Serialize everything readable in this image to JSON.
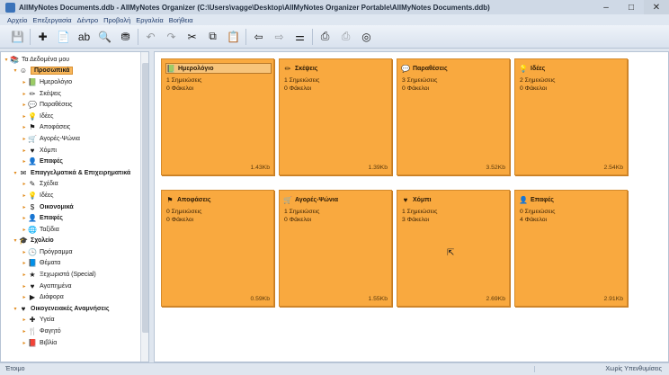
{
  "window": {
    "title": "AllMyNotes Documents.ddb - AllMyNotes Organizer (C:\\Users\\vagge\\Desktop\\AllMyNotes Organizer Portable\\AllMyNotes Documents.ddb)",
    "minimize": "–",
    "maximize": "□",
    "close": "✕"
  },
  "menu": [
    "Αρχείο",
    "Επεξεργασία",
    "Δέντρο",
    "Προβολή",
    "Εργαλεία",
    "Βοήθεια"
  ],
  "toolbar": [
    {
      "name": "save-icon",
      "glyph": "💾",
      "enabled": false
    },
    {
      "sep": true
    },
    {
      "name": "new-note-icon",
      "glyph": "✚",
      "enabled": true
    },
    {
      "name": "new-child-note-icon",
      "glyph": "📄",
      "enabled": true
    },
    {
      "name": "rename-icon",
      "glyph": "ab",
      "enabled": true
    },
    {
      "name": "find-icon",
      "glyph": "🔍",
      "enabled": true
    },
    {
      "name": "filter-icon",
      "glyph": "⛃",
      "enabled": true
    },
    {
      "sep": true
    },
    {
      "name": "undo-icon",
      "glyph": "↶",
      "enabled": false
    },
    {
      "name": "redo-icon",
      "glyph": "↷",
      "enabled": false
    },
    {
      "name": "cut-icon",
      "glyph": "✂",
      "enabled": true
    },
    {
      "name": "copy-icon",
      "glyph": "⧉",
      "enabled": true
    },
    {
      "name": "paste-icon",
      "glyph": "📋",
      "enabled": true
    },
    {
      "sep": true
    },
    {
      "name": "back-icon",
      "glyph": "⇦",
      "enabled": true
    },
    {
      "name": "forward-icon",
      "glyph": "⇨",
      "enabled": false
    },
    {
      "name": "equalizer-icon",
      "glyph": "⚌",
      "enabled": true
    },
    {
      "sep": true
    },
    {
      "name": "print-icon",
      "glyph": "⎙",
      "enabled": true
    },
    {
      "name": "print-preview-icon",
      "glyph": "⎙",
      "enabled": false
    },
    {
      "name": "help-lifebuoy-icon",
      "glyph": "◎",
      "enabled": true
    }
  ],
  "tree": [
    {
      "label": "Τα Δεδομένα μου",
      "level": 0,
      "icon": "📚",
      "bold": false,
      "sel": false,
      "arrow": "▾"
    },
    {
      "label": "Προσωπικά",
      "level": 1,
      "icon": "☺",
      "bold": true,
      "sel": true,
      "arrow": "▾"
    },
    {
      "label": "Ημερολόγιο",
      "level": 2,
      "icon": "📗",
      "bold": false,
      "sel": false,
      "arrow": "▸"
    },
    {
      "label": "Σκέψεις",
      "level": 2,
      "icon": "✏",
      "bold": false,
      "sel": false,
      "arrow": "▸"
    },
    {
      "label": "Παραθέσεις",
      "level": 2,
      "icon": "💬",
      "bold": false,
      "sel": false,
      "arrow": "▸"
    },
    {
      "label": "Ιδέες",
      "level": 2,
      "icon": "💡",
      "bold": false,
      "sel": false,
      "arrow": "▸"
    },
    {
      "label": "Αποφάσεις",
      "level": 2,
      "icon": "⚑",
      "bold": false,
      "sel": false,
      "arrow": "▸"
    },
    {
      "label": "Αγορές-Ψώνια",
      "level": 2,
      "icon": "🛒",
      "bold": false,
      "sel": false,
      "arrow": "▸"
    },
    {
      "label": "Χόμπι",
      "level": 2,
      "icon": "♥",
      "bold": false,
      "sel": false,
      "arrow": "▸"
    },
    {
      "label": "Επαφές",
      "level": 2,
      "icon": "👤",
      "bold": true,
      "sel": false,
      "arrow": "▸"
    },
    {
      "label": "Επαγγελματικά & Επιχειρηματικά",
      "level": 1,
      "icon": "✉",
      "bold": true,
      "sel": false,
      "arrow": "▾"
    },
    {
      "label": "Σχέδια",
      "level": 2,
      "icon": "✎",
      "bold": false,
      "sel": false,
      "arrow": "▸"
    },
    {
      "label": "Ιδέες",
      "level": 2,
      "icon": "💡",
      "bold": false,
      "sel": false,
      "arrow": "▸"
    },
    {
      "label": "Οικονομικά",
      "level": 2,
      "icon": "$",
      "bold": true,
      "sel": false,
      "arrow": "▸"
    },
    {
      "label": "Επαφές",
      "level": 2,
      "icon": "👤",
      "bold": true,
      "sel": false,
      "arrow": "▸"
    },
    {
      "label": "Ταξίδια",
      "level": 2,
      "icon": "🌐",
      "bold": false,
      "sel": false,
      "arrow": "▸"
    },
    {
      "label": "Σχολείο",
      "level": 1,
      "icon": "🎓",
      "bold": true,
      "sel": false,
      "arrow": "▾"
    },
    {
      "label": "Πρόγραμμα",
      "level": 2,
      "icon": "🕒",
      "bold": false,
      "sel": false,
      "arrow": "▸"
    },
    {
      "label": "Θέματα",
      "level": 2,
      "icon": "📘",
      "bold": false,
      "sel": false,
      "arrow": "▸"
    },
    {
      "label": "Ξεχωριστά (Special)",
      "level": 2,
      "icon": "★",
      "bold": false,
      "sel": false,
      "arrow": "▸"
    },
    {
      "label": "Αγαπημένα",
      "level": 2,
      "icon": "♥",
      "bold": false,
      "sel": false,
      "arrow": "▸"
    },
    {
      "label": "Διάφορα",
      "level": 2,
      "icon": "▶",
      "bold": false,
      "sel": false,
      "arrow": "▸"
    },
    {
      "label": "Οικογενειακές Αναμνήσεις",
      "level": 1,
      "icon": "♥",
      "bold": true,
      "sel": false,
      "arrow": "▾"
    },
    {
      "label": "Υγεία",
      "level": 2,
      "icon": "✚",
      "bold": false,
      "sel": false,
      "arrow": "▸"
    },
    {
      "label": "Φαγητό",
      "level": 2,
      "icon": "🍴",
      "bold": false,
      "sel": false,
      "arrow": "▸"
    },
    {
      "label": "Βιβλία",
      "level": 2,
      "icon": "📕",
      "bold": false,
      "sel": false,
      "arrow": "▸"
    }
  ],
  "folders": [
    {
      "name": "Ημερολόγιο",
      "icon": "📗",
      "notes": "1 Σημειώσεις",
      "subfolders": "0 Φάκελοι",
      "size": "1.43Kb"
    },
    {
      "name": "Σκέψεις",
      "icon": "✏",
      "notes": "1 Σημειώσεις",
      "subfolders": "0 Φάκελοι",
      "size": "1.39Kb"
    },
    {
      "name": "Παραθέσεις",
      "icon": "💬",
      "notes": "3 Σημειώσεις",
      "subfolders": "0 Φάκελοι",
      "size": "3.52Kb"
    },
    {
      "name": "Ιδέες",
      "icon": "💡",
      "notes": "2 Σημειώσεις",
      "subfolders": "0 Φάκελοι",
      "size": "2.54Kb"
    },
    {
      "name": "Αποφάσεις",
      "icon": "⚑",
      "notes": "0 Σημειώσεις",
      "subfolders": "0 Φάκελοι",
      "size": "0.59Kb"
    },
    {
      "name": "Αγορές-Ψώνια",
      "icon": "🛒",
      "notes": "1 Σημειώσεις",
      "subfolders": "0 Φάκελοι",
      "size": "1.55Kb"
    },
    {
      "name": "Χόμπι",
      "icon": "♥",
      "notes": "1 Σημειώσεις",
      "subfolders": "3 Φάκελοι",
      "size": "2.69Kb"
    },
    {
      "name": "Επαφές",
      "icon": "👤",
      "notes": "0 Σημειώσεις",
      "subfolders": "4 Φάκελοι",
      "size": "2.91Kb"
    }
  ],
  "status": {
    "left": "Έτοιμο",
    "right": "Χωρίς Υπενθυμίσεις"
  }
}
